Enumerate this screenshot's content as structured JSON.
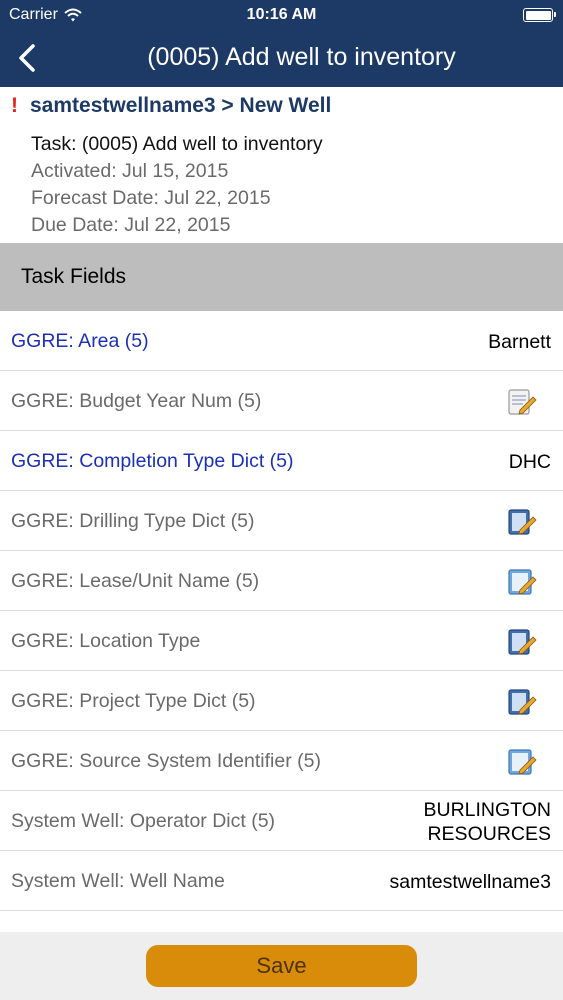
{
  "status_bar": {
    "carrier": "Carrier",
    "time": "10:16 AM"
  },
  "nav": {
    "title": "(0005) Add well to inventory"
  },
  "header": {
    "breadcrumb": "samtestwellname3 > New Well",
    "alert_mark": "!",
    "task": "Task: (0005) Add well to inventory",
    "activated": "Activated: Jul 15, 2015",
    "forecast": "Forecast Date: Jul 22, 2015",
    "due": "Due Date: Jul 22, 2015"
  },
  "section": {
    "title": "Task Fields"
  },
  "fields": [
    {
      "name": "GGRE: Area (5)",
      "value": "Barnett"
    },
    {
      "name": "GGRE: Budget Year Num (5)",
      "icon": "edit-note-icon"
    },
    {
      "name": "GGRE: Completion Type Dict (5)",
      "value": "DHC"
    },
    {
      "name": "GGRE: Drilling Type Dict (5)",
      "icon": "edit-note-icon"
    },
    {
      "name": "GGRE: Lease/Unit Name (5)",
      "icon": "edit-note-icon"
    },
    {
      "name": "GGRE: Location Type",
      "icon": "edit-note-icon"
    },
    {
      "name": "GGRE: Project Type Dict (5)",
      "icon": "edit-note-icon"
    },
    {
      "name": "GGRE: Source System Identifier (5)",
      "icon": "edit-note-icon"
    },
    {
      "name": "System Well: Operator Dict (5)",
      "value_line1": "BURLINGTON",
      "value_line2": "RESOURCES"
    },
    {
      "name": "System Well: Well Name",
      "value": "samtestwellname3"
    }
  ],
  "footer": {
    "save_label": "Save"
  },
  "colors": {
    "navbar": "#1d3a66",
    "link_blue": "#1b2fb8",
    "alert_red": "#e0261b",
    "save_orange": "#d98c09",
    "section_gray": "#bdbdbd"
  }
}
